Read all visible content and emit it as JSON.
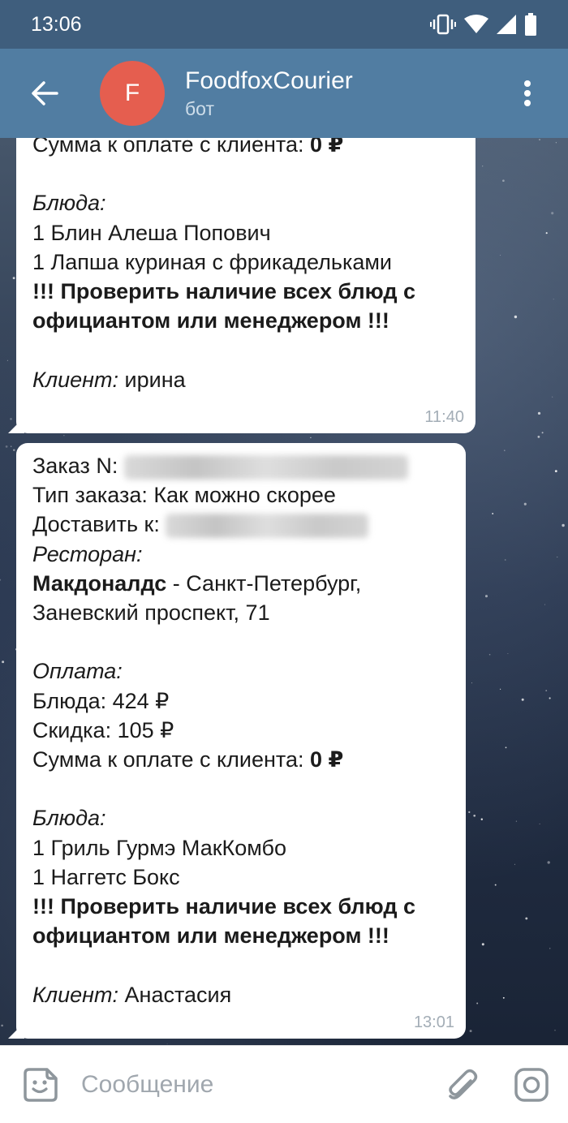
{
  "status_bar": {
    "time": "13:06"
  },
  "header": {
    "avatar_letter": "F",
    "title": "FoodfoxCourier",
    "subtitle": "бот"
  },
  "messages": [
    {
      "lines": [
        {
          "segments": [
            {
              "text": "Сумма к оплате с клиента: ",
              "style": "normal"
            },
            {
              "text": "0 ₽",
              "style": "bold"
            }
          ]
        },
        {
          "segments": []
        },
        {
          "segments": [
            {
              "text": "Блюда:",
              "style": "italic"
            }
          ]
        },
        {
          "segments": [
            {
              "text": "1 Блин Алеша Попович",
              "style": "normal"
            }
          ]
        },
        {
          "segments": [
            {
              "text": "1 Лапша куриная с фрикадельками",
              "style": "normal"
            }
          ]
        },
        {
          "segments": [
            {
              "text": "!!! Проверить наличие всех блюд с",
              "style": "bold"
            }
          ]
        },
        {
          "segments": [
            {
              "text": "официантом или менеджером !!!",
              "style": "bold"
            }
          ]
        },
        {
          "segments": []
        },
        {
          "segments": [
            {
              "text": "Клиент:",
              "style": "italic"
            },
            {
              "text": " ирина",
              "style": "normal"
            }
          ]
        }
      ],
      "time": "11:40"
    },
    {
      "lines": [
        {
          "segments": [
            {
              "text": "Заказ N: ",
              "style": "normal"
            }
          ]
        },
        {
          "segments": [
            {
              "text": "Тип заказа: Как можно скорее",
              "style": "normal"
            }
          ]
        },
        {
          "segments": [
            {
              "text": "Доставить к: ",
              "style": "normal"
            }
          ]
        },
        {
          "segments": [
            {
              "text": "Ресторан:",
              "style": "italic"
            }
          ]
        },
        {
          "segments": [
            {
              "text": "Макдоналдс",
              "style": "bold"
            },
            {
              "text": " - Санкт-Петербург,",
              "style": "normal"
            }
          ]
        },
        {
          "segments": [
            {
              "text": "Заневский проспект, 71",
              "style": "normal"
            }
          ]
        },
        {
          "segments": []
        },
        {
          "segments": [
            {
              "text": "Оплата:",
              "style": "italic"
            }
          ]
        },
        {
          "segments": [
            {
              "text": "Блюда: 424 ₽",
              "style": "normal"
            }
          ]
        },
        {
          "segments": [
            {
              "text": "Скидка: 105 ₽",
              "style": "normal"
            }
          ]
        },
        {
          "segments": [
            {
              "text": "Сумма к оплате с клиента: ",
              "style": "normal"
            },
            {
              "text": "0 ₽",
              "style": "bold"
            }
          ]
        },
        {
          "segments": []
        },
        {
          "segments": [
            {
              "text": "Блюда:",
              "style": "italic"
            }
          ]
        },
        {
          "segments": [
            {
              "text": "1 Гриль Гурмэ МакКомбо",
              "style": "normal"
            }
          ]
        },
        {
          "segments": [
            {
              "text": "1 Наггетс Бокс",
              "style": "normal"
            }
          ]
        },
        {
          "segments": [
            {
              "text": "!!! Проверить наличие всех блюд с",
              "style": "bold"
            }
          ]
        },
        {
          "segments": [
            {
              "text": "официантом или менеджером !!!",
              "style": "bold"
            }
          ]
        },
        {
          "segments": []
        },
        {
          "segments": [
            {
              "text": "Клиент:",
              "style": "italic"
            },
            {
              "text": " Анастасия",
              "style": "normal"
            }
          ]
        }
      ],
      "time": "13:01"
    }
  ],
  "composer": {
    "placeholder": "Сообщение"
  }
}
